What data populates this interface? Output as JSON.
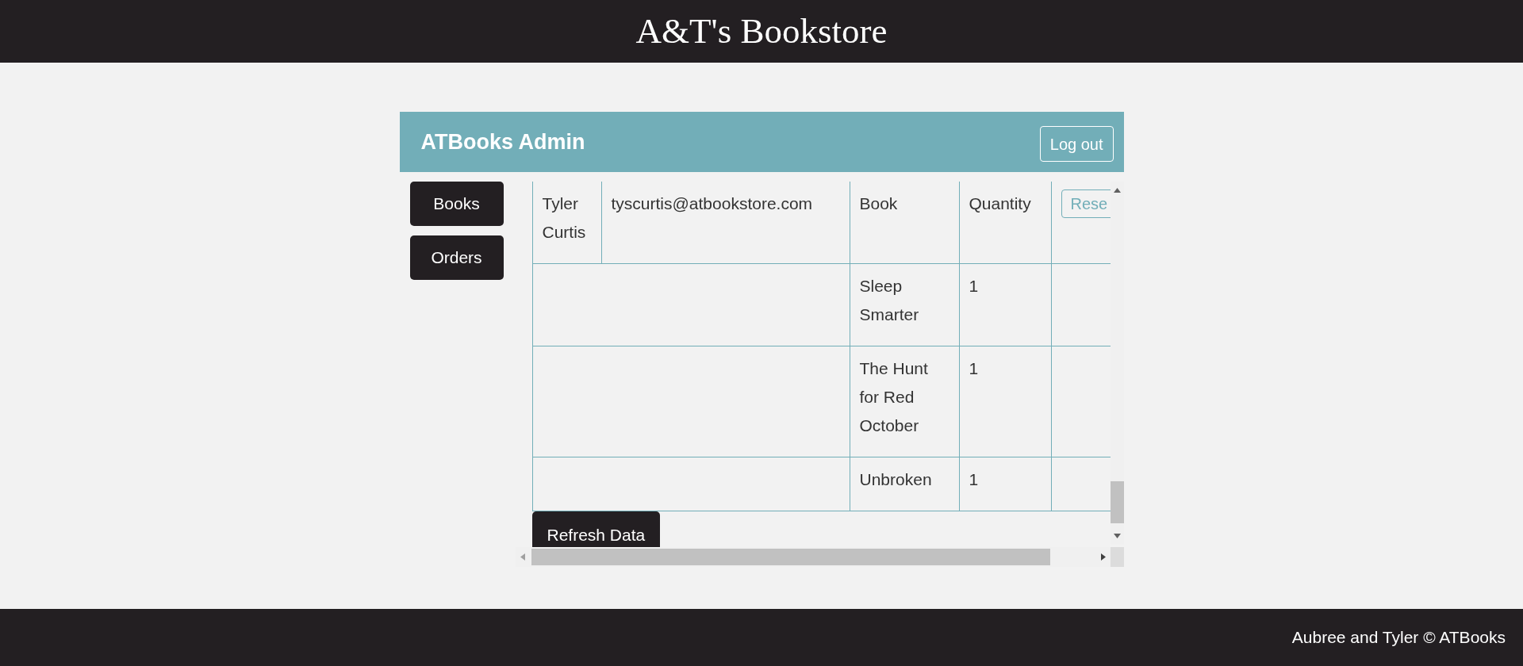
{
  "site_title": "A&T's Bookstore",
  "panel": {
    "title": "ATBooks Admin",
    "logout": "Log out"
  },
  "nav": [
    {
      "label": "Books"
    },
    {
      "label": "Orders"
    }
  ],
  "order": {
    "customer": "Tyler Curtis",
    "email": "tyscurtis@atbookstore.com",
    "book_heading": "Book",
    "quantity_heading": "Quantity",
    "reset": "Rese",
    "items": [
      {
        "book": "Sleep Smarter",
        "quantity": "1"
      },
      {
        "book": "The Hunt for Red October",
        "quantity": "1"
      },
      {
        "book": "Unbroken",
        "quantity": "1"
      }
    ]
  },
  "refresh": "Refresh Data",
  "footer": "Aubree and Tyler © ATBooks"
}
